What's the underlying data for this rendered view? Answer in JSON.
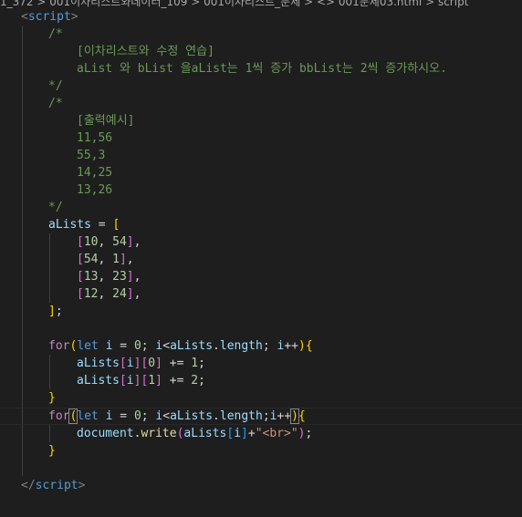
{
  "breadcrumb": "1_372 > 001이차리스트와데이터_109 > 001이차리스트_문제 > <> 001문제03.html > script",
  "code": {
    "script_open": "script",
    "comment1": {
      "open": "/*",
      "line1": "[이차리스트와 수정 연습]",
      "line2": "aList 와 bList 을aList는 1씩 증가 bbList는 2씩 증가하시오.",
      "close": "*/"
    },
    "comment2": {
      "open": "/*",
      "line1": "[출력예시]",
      "outputs": [
        "11,56",
        "55,3",
        "14,25",
        "13,26"
      ],
      "close": "*/"
    },
    "array_var": "aLists",
    "rows": [
      [
        "10",
        "54"
      ],
      [
        "54",
        "1"
      ],
      [
        "13",
        "23"
      ],
      [
        "12",
        "24"
      ]
    ],
    "loop_kw_for": "for",
    "loop_kw_let": "let",
    "loop_var": "i",
    "zero": "0",
    "length_prop": "length",
    "idx0": "0",
    "idx1": "1",
    "inc1": "1",
    "inc2": "2",
    "document_obj": "document",
    "write_fn": "write",
    "br_str": "\"<br>\"",
    "script_close": "script"
  }
}
